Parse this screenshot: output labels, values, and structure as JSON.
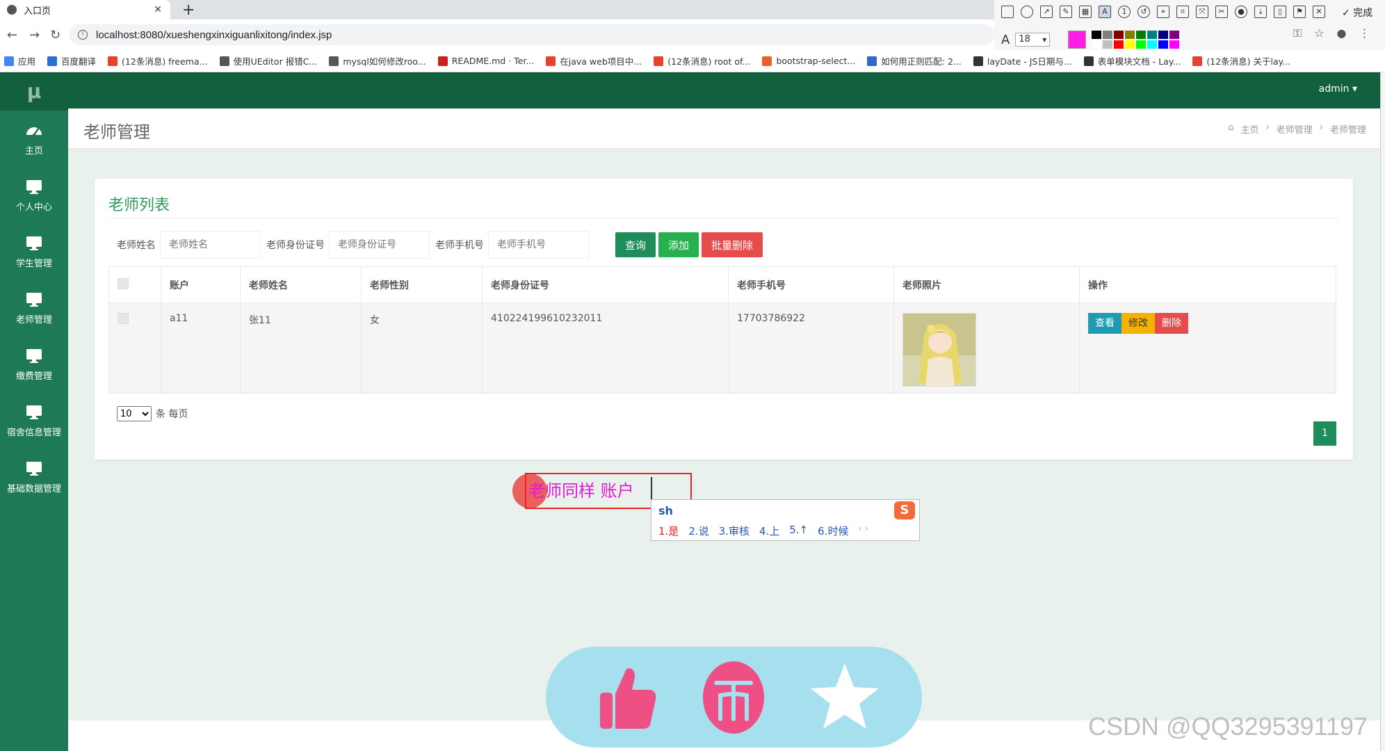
{
  "browser": {
    "tab_title": "入口页",
    "tab_close": "✕",
    "new_tab": "+",
    "url": "localhost:8080/xueshengxinxiguanlixitong/index.jsp",
    "bookmarks": [
      {
        "label": "应用",
        "icon_color": "#4285f4"
      },
      {
        "label": "百度翻译",
        "icon_color": "#2b6fd6"
      },
      {
        "label": "(12条消息) freema...",
        "icon_color": "#e8412c"
      },
      {
        "label": "使用UEditor 报错C...",
        "icon_color": "#555555"
      },
      {
        "label": "mysql如何修改roo...",
        "icon_color": "#555555"
      },
      {
        "label": "README.md · Ter...",
        "icon_color": "#c7211c"
      },
      {
        "label": "在java web项目中...",
        "icon_color": "#e8412c"
      },
      {
        "label": "(12条消息) root of...",
        "icon_color": "#e8412c"
      },
      {
        "label": "bootstrap-select...",
        "icon_color": "#e8622c"
      },
      {
        "label": "如何用正则匹配: 2...",
        "icon_color": "#3366cc"
      },
      {
        "label": "layDate - JS日期与...",
        "icon_color": "#333333"
      },
      {
        "label": "表单模块文档 - Lay...",
        "icon_color": "#333333"
      },
      {
        "label": "(12条消息) 关于lay...",
        "icon_color": "#e8412c"
      }
    ]
  },
  "annotator": {
    "font_size": "18",
    "done_label": "✓ 完成",
    "current_color": "#ff1ee6",
    "palette": [
      "#000000",
      "#808080",
      "#800000",
      "#808000",
      "#008000",
      "#008080",
      "#000080",
      "#800080",
      "#ffffff",
      "#c0c0c0",
      "#ff0000",
      "#ffff00",
      "#00ff00",
      "#00ffff",
      "#0000ff",
      "#ff00ff"
    ]
  },
  "app": {
    "logo": "μ",
    "user": "admin ▾",
    "sidebar": [
      {
        "label": "主页",
        "icon": "dashboard-icon"
      },
      {
        "label": "个人中心",
        "icon": "monitor-icon"
      },
      {
        "label": "学生管理",
        "icon": "monitor-icon"
      },
      {
        "label": "老师管理",
        "icon": "monitor-icon"
      },
      {
        "label": "缴费管理",
        "icon": "monitor-icon"
      },
      {
        "label": "宿舍信息管理",
        "icon": "monitor-icon"
      },
      {
        "label": "基础数据管理",
        "icon": "monitor-icon"
      }
    ],
    "page_title": "老师管理",
    "breadcrumb": {
      "home": "主页",
      "sep": "›",
      "level1": "老师管理",
      "level2": "老师管理"
    },
    "panel_title": "老师列表",
    "search": {
      "name_label": "老师姓名",
      "name_placeholder": "老师姓名",
      "id_label": "老师身份证号",
      "id_placeholder": "老师身份证号",
      "phone_label": "老师手机号",
      "phone_placeholder": "老师手机号"
    },
    "buttons": {
      "query": "查询",
      "add": "添加",
      "batch_delete": "批量删除"
    },
    "table": {
      "headers": [
        "账户",
        "老师姓名",
        "老师性别",
        "老师身份证号",
        "老师手机号",
        "老师照片",
        "操作"
      ],
      "rows": [
        {
          "account": "a11",
          "name": "张11",
          "gender": "女",
          "id_number": "410224199610232011",
          "phone": "17703786922"
        }
      ],
      "row_actions": {
        "view": "查看",
        "edit": "修改",
        "delete": "删除"
      }
    },
    "pager": {
      "page_size": "10",
      "suffix": "条 每页",
      "current_page": "1"
    }
  },
  "overlay": {
    "annotation_text": "老师同样  账户",
    "ime_input": "sh",
    "ime_candidates": [
      "1.是",
      "2.说",
      "3.审核",
      "4.上",
      "5.↑",
      "6.时候"
    ],
    "ime_arrows": "‹ ›",
    "ime_logo": "S"
  },
  "watermark": "CSDN @QQ3295391197"
}
